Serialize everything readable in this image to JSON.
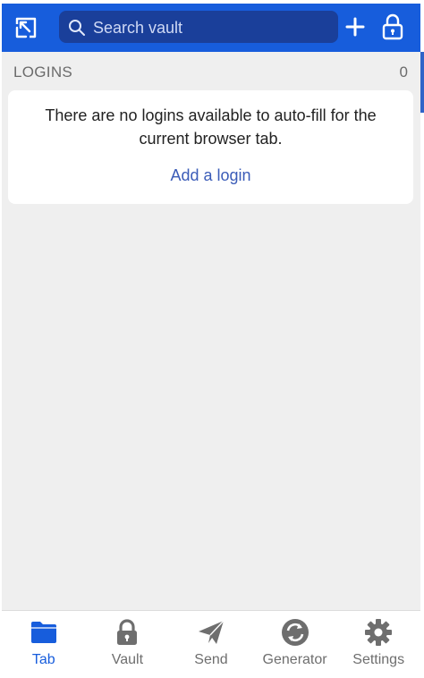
{
  "colors": {
    "brand": "#175ddc",
    "search_bg": "#1a3f9a",
    "background": "#efefef",
    "link": "#3b5cb8",
    "active_tab": "#175ddc",
    "inactive_tab": "#6e6e6e"
  },
  "header": {
    "pop_out_icon": "pop-out-icon",
    "search": {
      "placeholder": "Search vault",
      "value": ""
    },
    "add_icon": "plus-icon",
    "lock_icon": "lock-icon"
  },
  "logins": {
    "title": "LOGINS",
    "count": "0",
    "empty_message": "There are no logins available to auto-fill for the current browser tab.",
    "add_login_label": "Add a login"
  },
  "tabs": [
    {
      "label": "Tab",
      "icon": "folder-icon",
      "active": true
    },
    {
      "label": "Vault",
      "icon": "lock-icon",
      "active": false
    },
    {
      "label": "Send",
      "icon": "paper-plane-icon",
      "active": false
    },
    {
      "label": "Generator",
      "icon": "refresh-icon",
      "active": false
    },
    {
      "label": "Settings",
      "icon": "gear-icon",
      "active": false
    }
  ]
}
